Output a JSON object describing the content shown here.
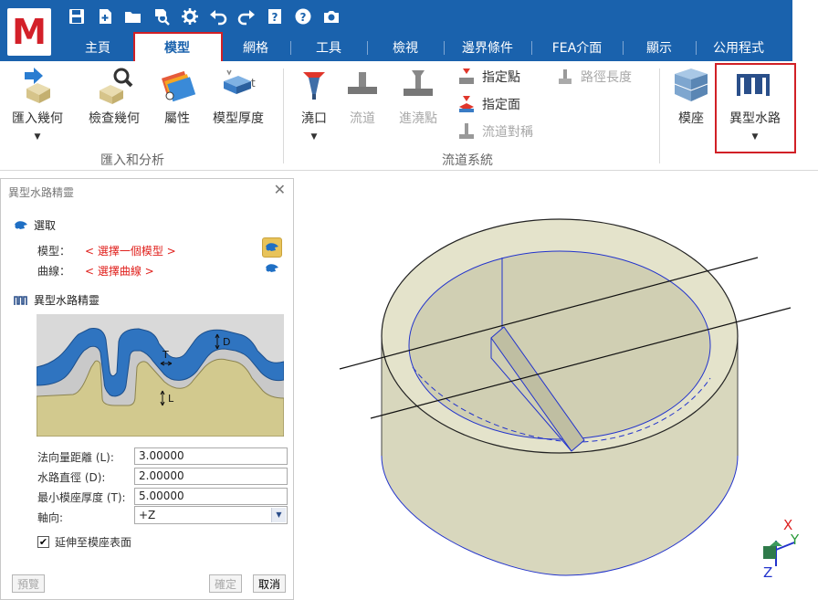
{
  "app": {
    "logo_letter": "M"
  },
  "quick_access": [
    "save-icon",
    "new-file-icon",
    "open-folder-icon",
    "find-icon",
    "settings-gear-icon",
    "undo-icon",
    "redo-icon",
    "help-book-icon",
    "help-icon",
    "camera-icon"
  ],
  "tabs": [
    {
      "label": "主頁"
    },
    {
      "label": "模型",
      "active": true
    },
    {
      "label": "網格"
    },
    {
      "label": "工具"
    },
    {
      "label": "檢視"
    },
    {
      "label": "邊界條件"
    },
    {
      "label": "FEA介面"
    },
    {
      "label": "顯示"
    },
    {
      "label": "公用程式"
    }
  ],
  "ribbon": {
    "import_geometry": "匯入幾何",
    "check_geometry": "檢查幾何",
    "properties": "屬性",
    "model_thickness": "模型厚度",
    "group_import": "匯入和分析",
    "sprue": "澆口",
    "runner": "流道",
    "gate": "進澆點",
    "specify_point": "指定點",
    "specify_surface": "指定面",
    "runner_symmetry": "流道對稱",
    "path_length": "路徑長度",
    "group_runner": "流道系統",
    "mold_base": "模座",
    "conformal_cooling": "異型水路"
  },
  "dialog": {
    "title": "異型水路精靈",
    "select_section": "選取",
    "model_label": "模型：",
    "model_value": "< 選擇一個模型 >",
    "curve_label": "曲線：",
    "curve_value": "< 選擇曲線 >",
    "wizard_section": "異型水路精靈",
    "diagram_labels": {
      "d": "D",
      "t": "T",
      "l": "L"
    },
    "fields": [
      {
        "label": "法向量距離 (L):",
        "value": "3.00000"
      },
      {
        "label": "水路直徑 (D):",
        "value": "2.00000"
      },
      {
        "label": "最小模座厚度 (T):",
        "value": "5.00000"
      }
    ],
    "axis_label": "軸向:",
    "axis_value": "+Z",
    "extend_label": "延伸至模座表面",
    "extend_checked": true,
    "preview_button": "預覽",
    "ok_button": "確定",
    "cancel_button": "取消"
  },
  "axes": {
    "x": "X",
    "y": "Y",
    "z": "Z"
  },
  "colors": {
    "ribbon_blue": "#1a62ad",
    "highlight_red": "#d12026",
    "model_surface": "#dcdcc4",
    "edge_blue": "#2233cc",
    "channel_blue": "#2f74c0"
  }
}
